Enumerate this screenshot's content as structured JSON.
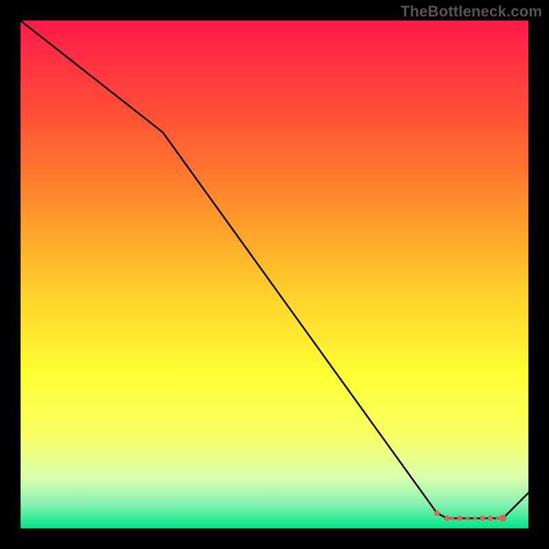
{
  "watermark": "TheBottleneck.com",
  "chart_data": {
    "type": "line",
    "title": "",
    "xlabel": "",
    "ylabel": "",
    "xlim": [
      0,
      100
    ],
    "ylim": [
      0,
      100
    ],
    "series": [
      {
        "name": "main-curve",
        "x": [
          0,
          28,
          82,
          84,
          86,
          88,
          90,
          92,
          94,
          95,
          100
        ],
        "values": [
          100,
          78,
          3,
          2,
          2,
          2,
          2,
          2,
          2,
          2,
          7
        ]
      }
    ],
    "markers": {
      "name": "highlight-points",
      "x": [
        82,
        84,
        85,
        86.5,
        88,
        89.5,
        91,
        92.5,
        94,
        95
      ],
      "values": [
        3,
        2,
        2,
        2,
        2,
        2,
        2,
        2,
        2,
        2
      ],
      "radius": [
        4,
        4,
        3,
        4,
        3,
        3,
        4,
        4,
        3,
        5
      ]
    },
    "gradient_stops": [
      {
        "offset": 0.0,
        "color": "#ff1a4b"
      },
      {
        "offset": 0.2,
        "color": "#ff5533"
      },
      {
        "offset": 0.4,
        "color": "#ff9c2a"
      },
      {
        "offset": 0.55,
        "color": "#ffd52a"
      },
      {
        "offset": 0.7,
        "color": "#ffff33"
      },
      {
        "offset": 0.82,
        "color": "#f7ff66"
      },
      {
        "offset": 0.9,
        "color": "#d9ffad"
      },
      {
        "offset": 0.95,
        "color": "#8cf2b0"
      },
      {
        "offset": 1.0,
        "color": "#00e587"
      }
    ],
    "line_color": "#000000",
    "marker_color": "#e0615e"
  }
}
